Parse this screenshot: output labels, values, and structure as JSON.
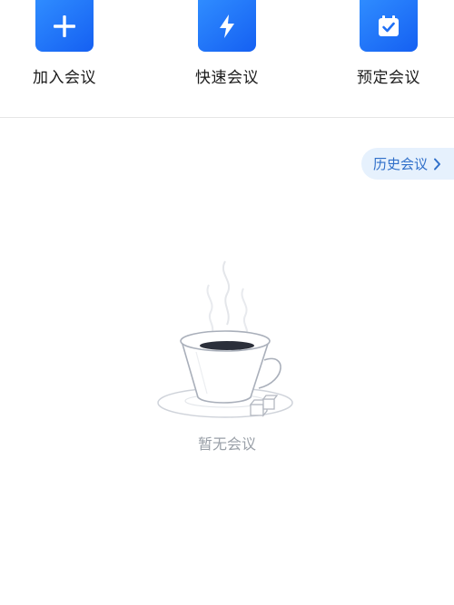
{
  "actions": [
    {
      "label": "加入会议",
      "icon": "plus-icon"
    },
    {
      "label": "快速会议",
      "icon": "lightning-icon"
    },
    {
      "label": "预定会议",
      "icon": "calendar-check-icon"
    }
  ],
  "history": {
    "label": "历史会议",
    "icon": "chevron-right-icon"
  },
  "empty_state": {
    "text": "暂无会议",
    "icon": "coffee-cup-illustration"
  },
  "colors": {
    "accent": "#1E6FF5",
    "history_bg": "#E6F1FD",
    "history_text": "#2F6FC9",
    "empty_text": "#9AA0A8"
  }
}
